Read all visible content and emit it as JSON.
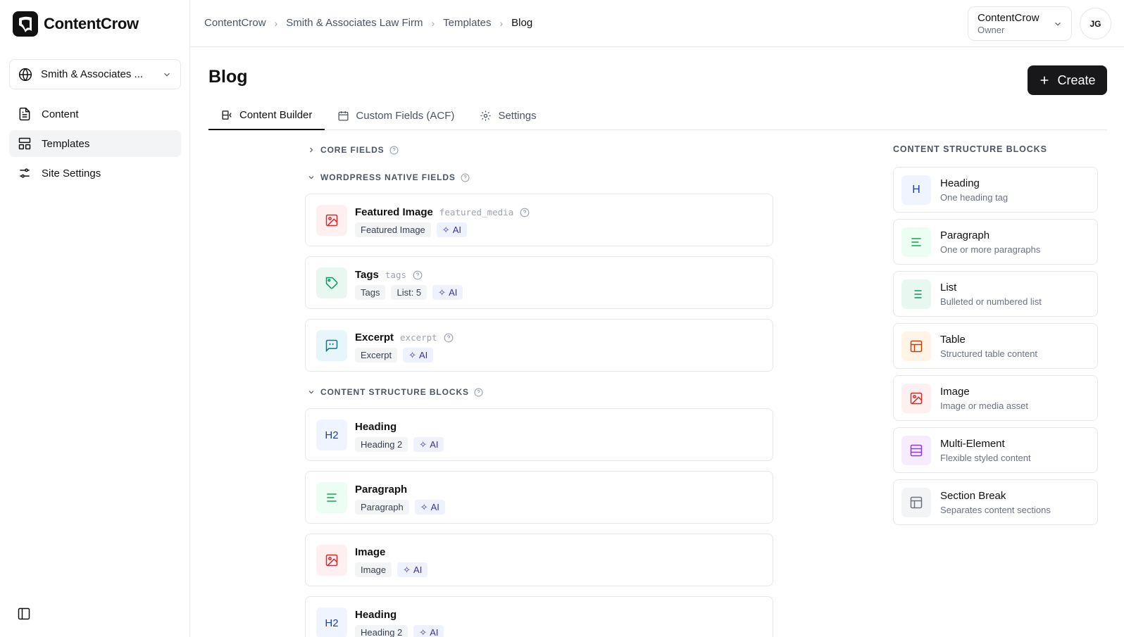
{
  "app": {
    "name": "ContentCrow"
  },
  "sidebar": {
    "site_selector": "Smith & Associates ...",
    "items": [
      {
        "label": "Content",
        "icon": "document-icon"
      },
      {
        "label": "Templates",
        "icon": "layout-icon",
        "active": true
      },
      {
        "label": "Site Settings",
        "icon": "sliders-icon"
      }
    ]
  },
  "breadcrumb": [
    "ContentCrow",
    "Smith & Associates Law Firm",
    "Templates",
    "Blog"
  ],
  "account": {
    "name": "ContentCrow",
    "role": "Owner",
    "initials": "JG"
  },
  "page": {
    "title": "Blog",
    "create_label": "Create"
  },
  "tabs": [
    {
      "label": "Content Builder",
      "icon": "builder-icon",
      "active": true
    },
    {
      "label": "Custom Fields (ACF)",
      "icon": "calendar-icon"
    },
    {
      "label": "Settings",
      "icon": "gear-icon"
    }
  ],
  "builder": {
    "sections": {
      "core": "CORE FIELDS",
      "wordpress": "WORDPRESS NATIVE FIELDS",
      "structure": "CONTENT STRUCTURE BLOCKS"
    },
    "wordpress_fields": [
      {
        "title": "Featured Image",
        "key": "featured_media",
        "chips": [
          "Featured Image"
        ],
        "ai": "AI"
      },
      {
        "title": "Tags",
        "key": "tags",
        "chips": [
          "Tags",
          "List: 5"
        ],
        "ai": "AI"
      },
      {
        "title": "Excerpt",
        "key": "excerpt",
        "chips": [
          "Excerpt"
        ],
        "ai": "AI"
      }
    ],
    "structure_blocks": [
      {
        "title": "Heading",
        "icon_text": "H2",
        "chips": [
          "Heading 2"
        ],
        "ai": "AI"
      },
      {
        "title": "Paragraph",
        "chips": [
          "Paragraph"
        ],
        "ai": "AI"
      },
      {
        "title": "Image",
        "chips": [
          "Image"
        ],
        "ai": "AI"
      },
      {
        "title": "Heading",
        "icon_text": "H2",
        "chips": [
          "Heading 2"
        ],
        "ai": "AI"
      }
    ]
  },
  "panel": {
    "title": "CONTENT STRUCTURE BLOCKS",
    "blocks": [
      {
        "title": "Heading",
        "desc": "One heading tag",
        "icon_text": "H"
      },
      {
        "title": "Paragraph",
        "desc": "One or more paragraphs"
      },
      {
        "title": "List",
        "desc": "Bulleted or numbered list"
      },
      {
        "title": "Table",
        "desc": "Structured table content"
      },
      {
        "title": "Image",
        "desc": "Image or media asset"
      },
      {
        "title": "Multi-Element",
        "desc": "Flexible styled content"
      },
      {
        "title": "Section Break",
        "desc": "Separates content sections"
      }
    ]
  }
}
